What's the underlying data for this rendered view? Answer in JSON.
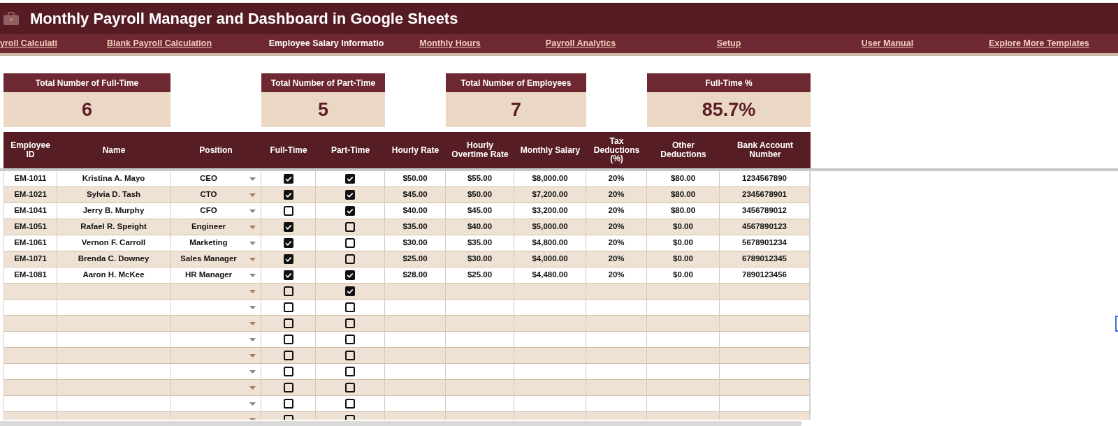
{
  "title_bar": {
    "title": "Monthly Payroll Manager and Dashboard in Google Sheets"
  },
  "nav_tabs": [
    {
      "label": "yroll Calculati",
      "selected": false
    },
    {
      "label": "Blank Payroll Calculation",
      "selected": false
    },
    {
      "label": "Employee Salary Informatio",
      "selected": true
    },
    {
      "label": "Monthly Hours",
      "selected": false
    },
    {
      "label": "Payroll Analytics",
      "selected": false
    },
    {
      "label": "Setup",
      "selected": false
    },
    {
      "label": "User Manual",
      "selected": false
    },
    {
      "label": "Explore More Templates",
      "selected": false
    }
  ],
  "summary_cards": [
    {
      "label": "Total Number of Full-Time",
      "value": "6"
    },
    {
      "label": "Total Number of Part-Time",
      "value": "5"
    },
    {
      "label": "Total Number of Employees",
      "value": "7"
    },
    {
      "label": "Full-Time %",
      "value": "85.7%"
    }
  ],
  "table": {
    "columns": [
      {
        "label": "Employee ID",
        "kind": "text"
      },
      {
        "label": "Name",
        "kind": "text"
      },
      {
        "label": "Position",
        "kind": "dropdown"
      },
      {
        "label": "Full-Time",
        "kind": "checkbox"
      },
      {
        "label": "Part-Time",
        "kind": "checkbox"
      },
      {
        "label": "Hourly Rate",
        "kind": "text"
      },
      {
        "label": "Hourly Overtime Rate",
        "kind": "text"
      },
      {
        "label": "Monthly Salary",
        "kind": "text"
      },
      {
        "label": "Tax Deductions (%)",
        "kind": "text"
      },
      {
        "label": "Other Deductions",
        "kind": "text"
      },
      {
        "label": "Bank Account Number",
        "kind": "text"
      }
    ],
    "rows": [
      {
        "employee_id": "EM-1011",
        "name": "Kristina A. Mayo",
        "position": "CEO",
        "full_time": true,
        "part_time": true,
        "hourly_rate": "$50.00",
        "overtime_rate": "$55.00",
        "monthly_salary": "$8,000.00",
        "tax_deductions": "20%",
        "other_deductions": "$80.00",
        "bank_account": "1234567890"
      },
      {
        "employee_id": "EM-1021",
        "name": "Sylvia D. Tash",
        "position": "CTO",
        "full_time": true,
        "part_time": true,
        "hourly_rate": "$45.00",
        "overtime_rate": "$50.00",
        "monthly_salary": "$7,200.00",
        "tax_deductions": "20%",
        "other_deductions": "$80.00",
        "bank_account": "2345678901"
      },
      {
        "employee_id": "EM-1041",
        "name": "Jerry B. Murphy",
        "position": "CFO",
        "full_time": false,
        "part_time": true,
        "hourly_rate": "$40.00",
        "overtime_rate": "$45.00",
        "monthly_salary": "$3,200.00",
        "tax_deductions": "20%",
        "other_deductions": "$80.00",
        "bank_account": "3456789012"
      },
      {
        "employee_id": "EM-1051",
        "name": "Rafael R. Speight",
        "position": "Engineer",
        "full_time": true,
        "part_time": false,
        "hourly_rate": "$35.00",
        "overtime_rate": "$40.00",
        "monthly_salary": "$5,000.00",
        "tax_deductions": "20%",
        "other_deductions": "$0.00",
        "bank_account": "4567890123"
      },
      {
        "employee_id": "EM-1061",
        "name": "Vernon F. Carroll",
        "position": "Marketing",
        "full_time": true,
        "part_time": false,
        "hourly_rate": "$30.00",
        "overtime_rate": "$35.00",
        "monthly_salary": "$4,800.00",
        "tax_deductions": "20%",
        "other_deductions": "$0.00",
        "bank_account": "5678901234"
      },
      {
        "employee_id": "EM-1071",
        "name": "Brenda C. Downey",
        "position": "Sales Manager",
        "full_time": true,
        "part_time": false,
        "hourly_rate": "$25.00",
        "overtime_rate": "$30.00",
        "monthly_salary": "$4,000.00",
        "tax_deductions": "20%",
        "other_deductions": "$0.00",
        "bank_account": "6789012345"
      },
      {
        "employee_id": "EM-1081",
        "name": "Aaron H. McKee",
        "position": "HR Manager",
        "full_time": true,
        "part_time": true,
        "hourly_rate": "$28.00",
        "overtime_rate": "$25.00",
        "monthly_salary": "$4,480.00",
        "tax_deductions": "20%",
        "other_deductions": "$0.00",
        "bank_account": "7890123456"
      },
      {
        "full_time": false,
        "part_time": true
      },
      {
        "full_time": false,
        "part_time": false
      },
      {
        "full_time": false,
        "part_time": false
      },
      {
        "full_time": false,
        "part_time": false
      },
      {
        "full_time": false,
        "part_time": false
      },
      {
        "full_time": false,
        "part_time": false
      },
      {
        "full_time": false,
        "part_time": false
      },
      {
        "full_time": false,
        "part_time": false
      },
      {
        "full_time": false,
        "part_time": false
      }
    ]
  }
}
